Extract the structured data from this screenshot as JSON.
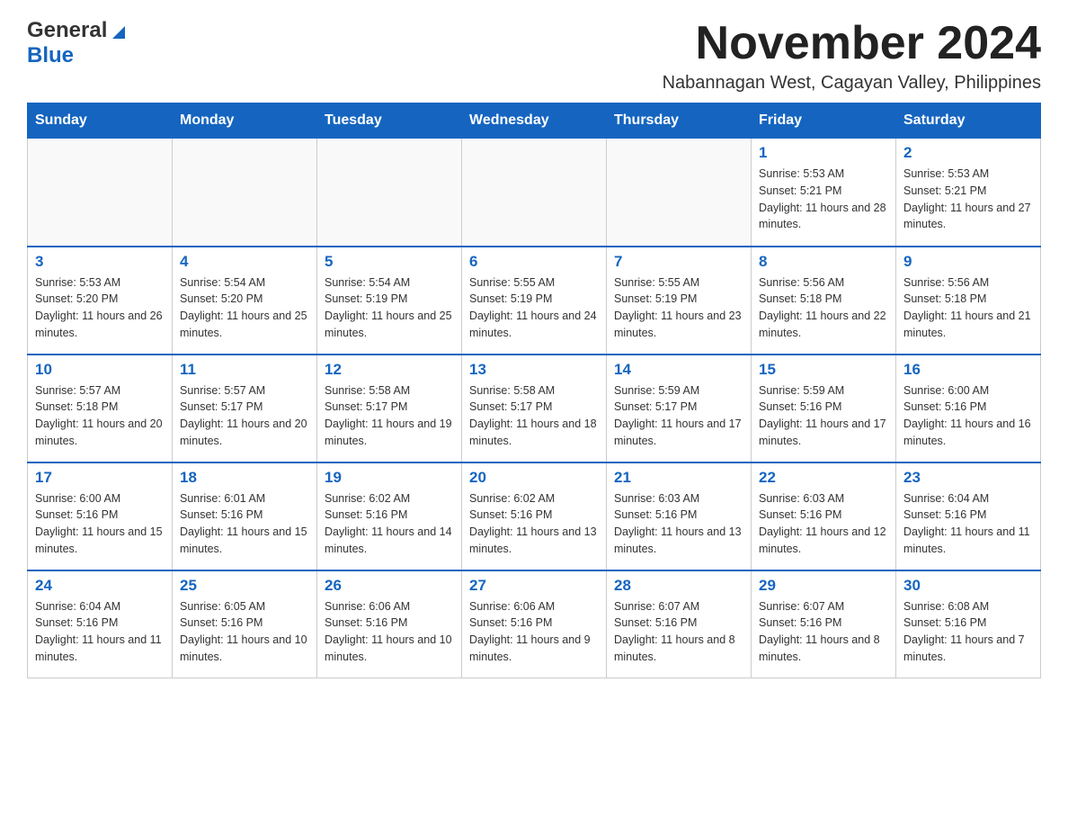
{
  "header": {
    "logo_general": "General",
    "logo_blue": "Blue",
    "month_title": "November 2024",
    "subtitle": "Nabannagan West, Cagayan Valley, Philippines"
  },
  "days_of_week": [
    "Sunday",
    "Monday",
    "Tuesday",
    "Wednesday",
    "Thursday",
    "Friday",
    "Saturday"
  ],
  "weeks": [
    [
      {
        "day": "",
        "info": ""
      },
      {
        "day": "",
        "info": ""
      },
      {
        "day": "",
        "info": ""
      },
      {
        "day": "",
        "info": ""
      },
      {
        "day": "",
        "info": ""
      },
      {
        "day": "1",
        "info": "Sunrise: 5:53 AM\nSunset: 5:21 PM\nDaylight: 11 hours and 28 minutes."
      },
      {
        "day": "2",
        "info": "Sunrise: 5:53 AM\nSunset: 5:21 PM\nDaylight: 11 hours and 27 minutes."
      }
    ],
    [
      {
        "day": "3",
        "info": "Sunrise: 5:53 AM\nSunset: 5:20 PM\nDaylight: 11 hours and 26 minutes."
      },
      {
        "day": "4",
        "info": "Sunrise: 5:54 AM\nSunset: 5:20 PM\nDaylight: 11 hours and 25 minutes."
      },
      {
        "day": "5",
        "info": "Sunrise: 5:54 AM\nSunset: 5:19 PM\nDaylight: 11 hours and 25 minutes."
      },
      {
        "day": "6",
        "info": "Sunrise: 5:55 AM\nSunset: 5:19 PM\nDaylight: 11 hours and 24 minutes."
      },
      {
        "day": "7",
        "info": "Sunrise: 5:55 AM\nSunset: 5:19 PM\nDaylight: 11 hours and 23 minutes."
      },
      {
        "day": "8",
        "info": "Sunrise: 5:56 AM\nSunset: 5:18 PM\nDaylight: 11 hours and 22 minutes."
      },
      {
        "day": "9",
        "info": "Sunrise: 5:56 AM\nSunset: 5:18 PM\nDaylight: 11 hours and 21 minutes."
      }
    ],
    [
      {
        "day": "10",
        "info": "Sunrise: 5:57 AM\nSunset: 5:18 PM\nDaylight: 11 hours and 20 minutes."
      },
      {
        "day": "11",
        "info": "Sunrise: 5:57 AM\nSunset: 5:17 PM\nDaylight: 11 hours and 20 minutes."
      },
      {
        "day": "12",
        "info": "Sunrise: 5:58 AM\nSunset: 5:17 PM\nDaylight: 11 hours and 19 minutes."
      },
      {
        "day": "13",
        "info": "Sunrise: 5:58 AM\nSunset: 5:17 PM\nDaylight: 11 hours and 18 minutes."
      },
      {
        "day": "14",
        "info": "Sunrise: 5:59 AM\nSunset: 5:17 PM\nDaylight: 11 hours and 17 minutes."
      },
      {
        "day": "15",
        "info": "Sunrise: 5:59 AM\nSunset: 5:16 PM\nDaylight: 11 hours and 17 minutes."
      },
      {
        "day": "16",
        "info": "Sunrise: 6:00 AM\nSunset: 5:16 PM\nDaylight: 11 hours and 16 minutes."
      }
    ],
    [
      {
        "day": "17",
        "info": "Sunrise: 6:00 AM\nSunset: 5:16 PM\nDaylight: 11 hours and 15 minutes."
      },
      {
        "day": "18",
        "info": "Sunrise: 6:01 AM\nSunset: 5:16 PM\nDaylight: 11 hours and 15 minutes."
      },
      {
        "day": "19",
        "info": "Sunrise: 6:02 AM\nSunset: 5:16 PM\nDaylight: 11 hours and 14 minutes."
      },
      {
        "day": "20",
        "info": "Sunrise: 6:02 AM\nSunset: 5:16 PM\nDaylight: 11 hours and 13 minutes."
      },
      {
        "day": "21",
        "info": "Sunrise: 6:03 AM\nSunset: 5:16 PM\nDaylight: 11 hours and 13 minutes."
      },
      {
        "day": "22",
        "info": "Sunrise: 6:03 AM\nSunset: 5:16 PM\nDaylight: 11 hours and 12 minutes."
      },
      {
        "day": "23",
        "info": "Sunrise: 6:04 AM\nSunset: 5:16 PM\nDaylight: 11 hours and 11 minutes."
      }
    ],
    [
      {
        "day": "24",
        "info": "Sunrise: 6:04 AM\nSunset: 5:16 PM\nDaylight: 11 hours and 11 minutes."
      },
      {
        "day": "25",
        "info": "Sunrise: 6:05 AM\nSunset: 5:16 PM\nDaylight: 11 hours and 10 minutes."
      },
      {
        "day": "26",
        "info": "Sunrise: 6:06 AM\nSunset: 5:16 PM\nDaylight: 11 hours and 10 minutes."
      },
      {
        "day": "27",
        "info": "Sunrise: 6:06 AM\nSunset: 5:16 PM\nDaylight: 11 hours and 9 minutes."
      },
      {
        "day": "28",
        "info": "Sunrise: 6:07 AM\nSunset: 5:16 PM\nDaylight: 11 hours and 8 minutes."
      },
      {
        "day": "29",
        "info": "Sunrise: 6:07 AM\nSunset: 5:16 PM\nDaylight: 11 hours and 8 minutes."
      },
      {
        "day": "30",
        "info": "Sunrise: 6:08 AM\nSunset: 5:16 PM\nDaylight: 11 hours and 7 minutes."
      }
    ]
  ]
}
